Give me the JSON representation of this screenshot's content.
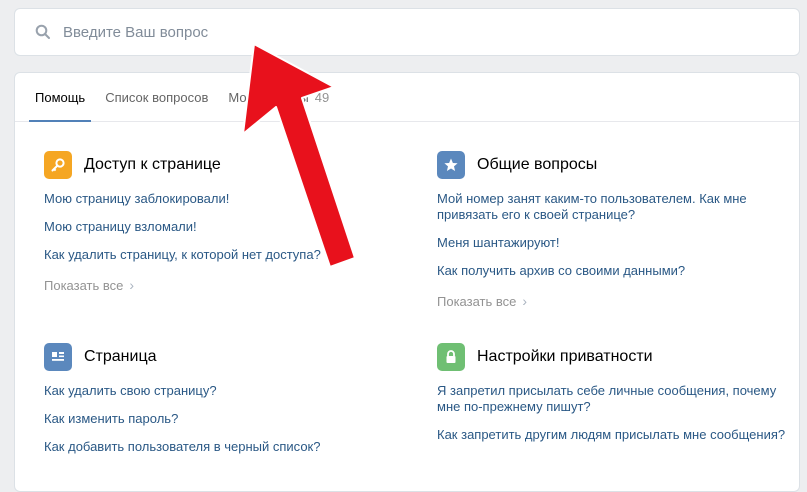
{
  "search": {
    "placeholder": "Введите Ваш вопрос"
  },
  "tabs": [
    {
      "label": "Помощь"
    },
    {
      "label": "Список вопросов"
    },
    {
      "label": "Мои вопросы",
      "count": "49"
    }
  ],
  "sections": [
    {
      "title": "Доступ к странице",
      "icon": "key-icon",
      "color": "#f5a623",
      "questions": [
        "Мою страницу заблокировали!",
        "Мою страницу взломали!",
        "Как удалить страницу, к которой нет доступа?"
      ],
      "more": "Показать все"
    },
    {
      "title": "Общие вопросы",
      "icon": "star-icon",
      "color": "#5b88bd",
      "questions": [
        "Мой номер занят каким-то пользователем. Как мне привязать его к своей странице?",
        "Меня шантажируют!",
        "Как получить архив со своими данными?"
      ],
      "more": "Показать все"
    },
    {
      "title": "Страница",
      "icon": "page-icon",
      "color": "#5b88bd",
      "questions": [
        "Как удалить свою страницу?",
        "Как изменить пароль?",
        "Как добавить пользователя в черный список?"
      ]
    },
    {
      "title": "Настройки приватности",
      "icon": "lock-icon",
      "color": "#6fbf73",
      "questions": [
        "Я запретил присылать себе личные сообщения, почему мне по-прежнему пишут?",
        "Как запретить другим людям присылать мне сообщения?"
      ]
    }
  ],
  "annotation": {
    "arrow_color": "#e8111c"
  }
}
